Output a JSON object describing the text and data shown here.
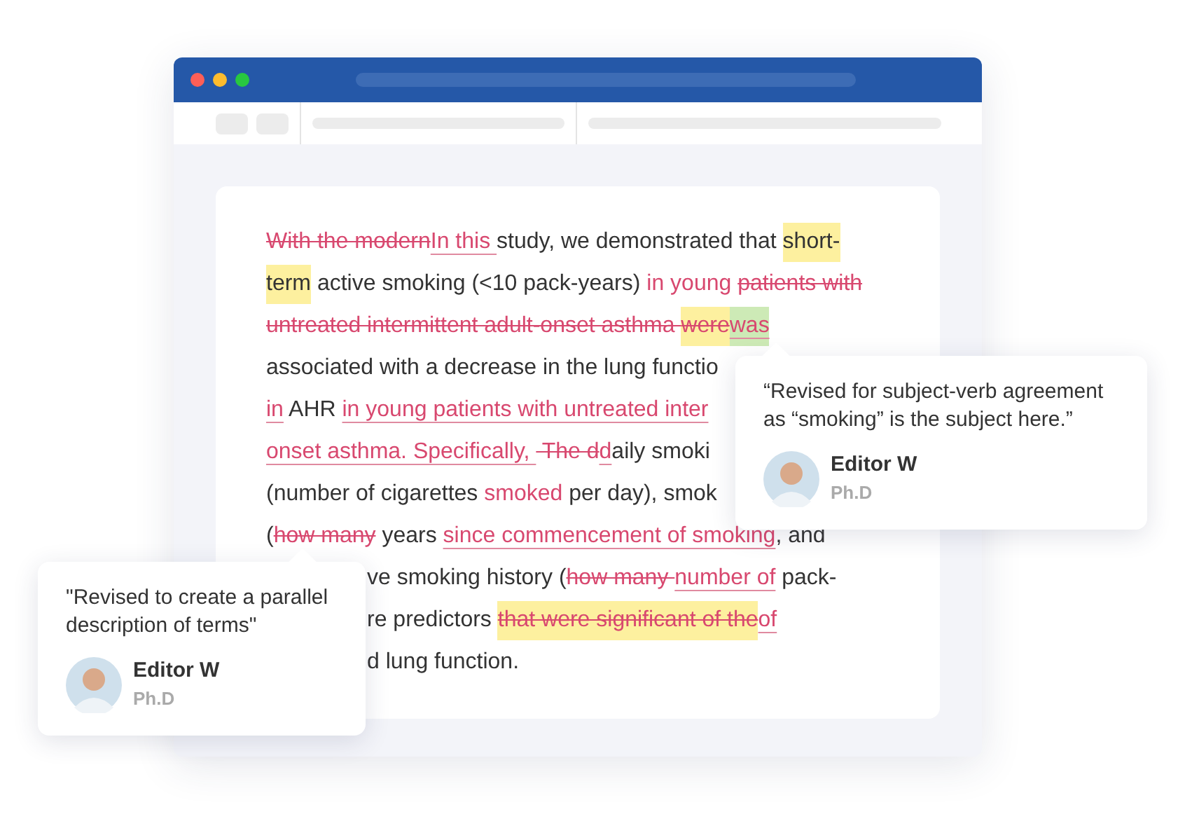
{
  "document": {
    "lines": [
      {
        "segments": [
          {
            "kind": "deleted",
            "text": "With the modern"
          },
          {
            "kind": "inserted",
            "text": "In this "
          },
          {
            "kind": "plain",
            "text": "study, we demonstrated that "
          },
          {
            "kind": "plain",
            "text": "short-",
            "color": "#fdf09f"
          }
        ]
      },
      {
        "segments": [
          {
            "kind": "plain",
            "text": "term",
            "color": "#fdf09f"
          },
          {
            "kind": "plain",
            "text": " active smoking (<10 pack-years) "
          },
          {
            "kind": "changed",
            "text": "in young "
          },
          {
            "kind": "deleted",
            "text": "patients with"
          }
        ]
      },
      {
        "segments": [
          {
            "kind": "deleted",
            "text": "untreated intermittent adult-onset asthma "
          },
          {
            "kind": "deleted",
            "text": "were",
            "color": "#fdf09f"
          },
          {
            "kind": "inserted",
            "text": "was",
            "color": "#cdeab6"
          }
        ]
      },
      {
        "segments": [
          {
            "kind": "plain",
            "text": "associated with a decrease in the lung functio"
          }
        ]
      },
      {
        "segments": [
          {
            "kind": "inserted",
            "text": "in"
          },
          {
            "kind": "plain",
            "text": " AHR "
          },
          {
            "kind": "inserted",
            "text": "in young patients with untreated inter"
          }
        ]
      },
      {
        "segments": [
          {
            "kind": "inserted",
            "text": "onset asthma. Specifically, "
          },
          {
            "kind": "deleted",
            "text": " The d"
          },
          {
            "kind": "inserted",
            "text": "d"
          },
          {
            "kind": "plain",
            "text": "aily smoki"
          }
        ]
      },
      {
        "segments": [
          {
            "kind": "plain",
            "text": "(number of cigarettes "
          },
          {
            "kind": "changed",
            "text": "smoked"
          },
          {
            "kind": "plain",
            "text": " per day), smok"
          }
        ]
      },
      {
        "segments": [
          {
            "kind": "plain",
            "text": "("
          },
          {
            "kind": "deleted",
            "text": "how many"
          },
          {
            "kind": "plain",
            "text": " years "
          },
          {
            "kind": "inserted",
            "text": "since commencement of smoking"
          },
          {
            "kind": "plain",
            "text": ", and"
          }
        ]
      },
      {
        "segments": [
          {
            "kind": "plain",
            "text": "ve smoking history ("
          },
          {
            "kind": "deleted",
            "text": "how many "
          },
          {
            "kind": "inserted",
            "text": "number of"
          },
          {
            "kind": "plain",
            "text": " pack-"
          }
        ]
      },
      {
        "segments": [
          {
            "kind": "plain",
            "text": "re predictors "
          },
          {
            "kind": "deleted",
            "text": "that were significant of the",
            "color": "#fdf09f"
          },
          {
            "kind": "inserted",
            "text": "of"
          }
        ]
      },
      {
        "segments": [
          {
            "kind": "plain",
            "text": "d lung function."
          }
        ]
      }
    ]
  },
  "notes": [
    {
      "text": "“Revised for subject-verb agreement as “smoking” is the subject here.”",
      "author": "Editor W",
      "degree": "Ph.D"
    },
    {
      "text": "\"Revised to create a parallel description of terms\"",
      "author": "Editor W",
      "degree": "Ph.D"
    }
  ]
}
